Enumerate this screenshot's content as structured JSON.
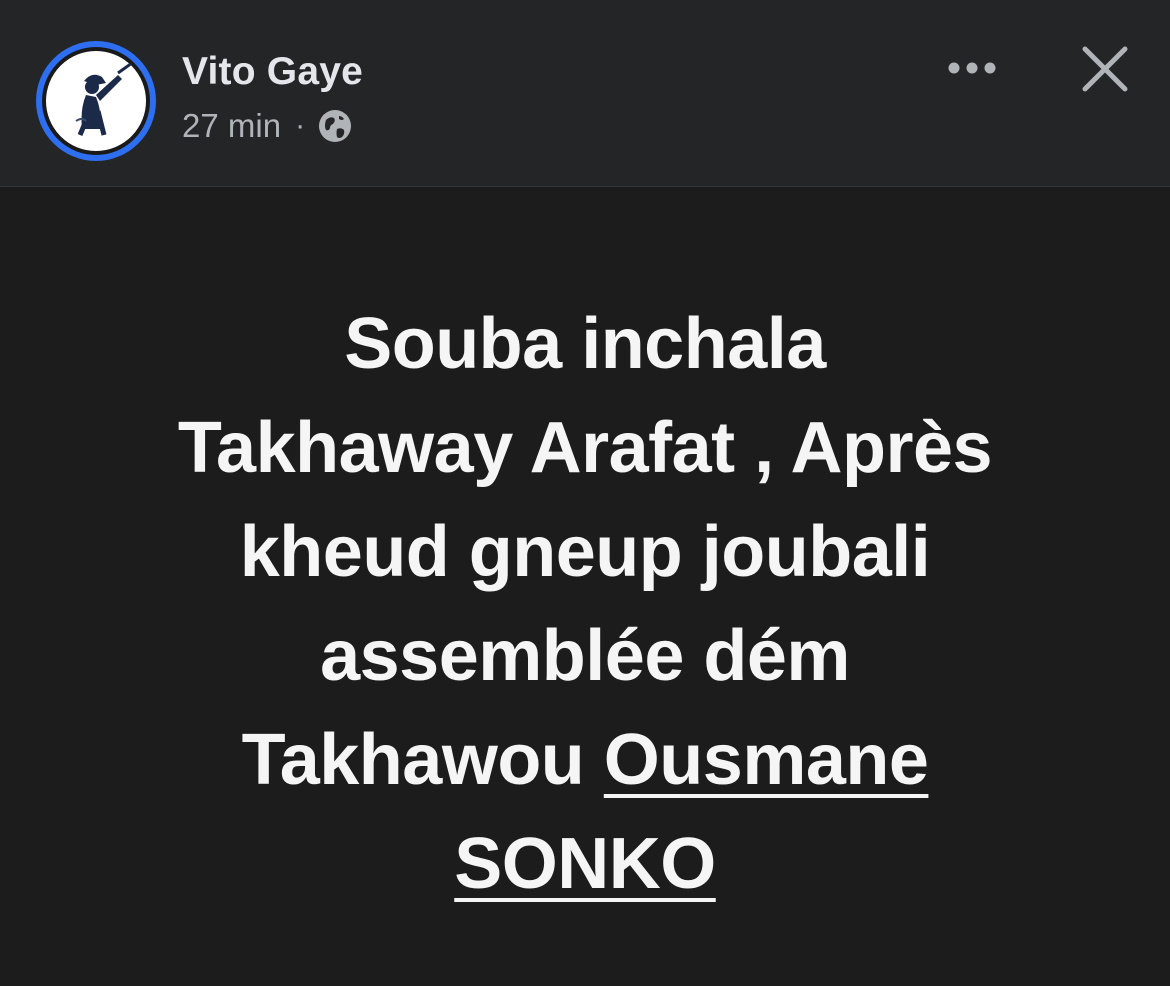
{
  "header": {
    "author_name": "Vito Gaye",
    "timestamp": "27 min",
    "separator": "·",
    "audience_icon": "globe-icon",
    "more_icon": "more-options-icon",
    "close_icon": "close-icon",
    "avatar_ring_color": "#2d6ff0"
  },
  "post": {
    "background_color": "#1c1c1c",
    "text_color": "#f5f5f5",
    "lines": [
      "Souba inchala",
      "Takhaway Arafat , Après",
      "kheud gneup joubali",
      "assemblée dém"
    ],
    "line5_prefix": "Takhawou ",
    "tag_part1": "Ousmane",
    "tag_part2": "SONKO"
  }
}
